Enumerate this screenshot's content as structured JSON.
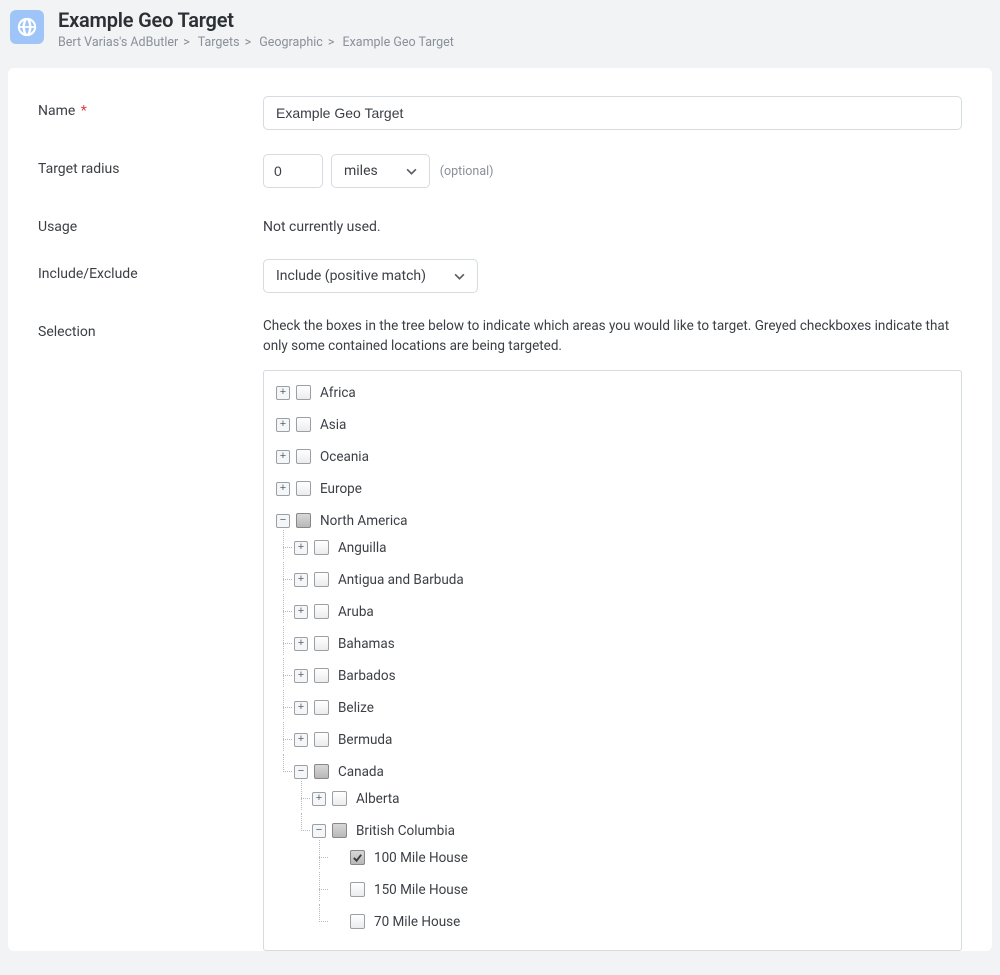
{
  "header": {
    "title": "Example Geo Target",
    "breadcrumb": [
      "Bert Varias's AdButler",
      "Targets",
      "Geographic",
      "Example Geo Target"
    ]
  },
  "form": {
    "name_label": "Name",
    "name_value": "Example Geo Target",
    "radius_label": "Target radius",
    "radius_value": "0",
    "radius_unit": "miles",
    "optional_text": "(optional)",
    "usage_label": "Usage",
    "usage_value": "Not currently used.",
    "incexc_label": "Include/Exclude",
    "incexc_value": "Include (positive match)",
    "selection_label": "Selection",
    "selection_helper": "Check the boxes in the tree below to indicate which areas you would like to target.  Greyed checkboxes indicate that only some contained locations are being targeted."
  },
  "tree": {
    "africa": "Africa",
    "asia": "Asia",
    "oceania": "Oceania",
    "europe": "Europe",
    "north_america": "North America",
    "anguilla": "Anguilla",
    "antigua": "Antigua and Barbuda",
    "aruba": "Aruba",
    "bahamas": "Bahamas",
    "barbados": "Barbados",
    "belize": "Belize",
    "bermuda": "Bermuda",
    "canada": "Canada",
    "alberta": "Alberta",
    "bc": "British Columbia",
    "c100": "100 Mile House",
    "c150": "150 Mile House",
    "c70": "70 Mile House"
  }
}
